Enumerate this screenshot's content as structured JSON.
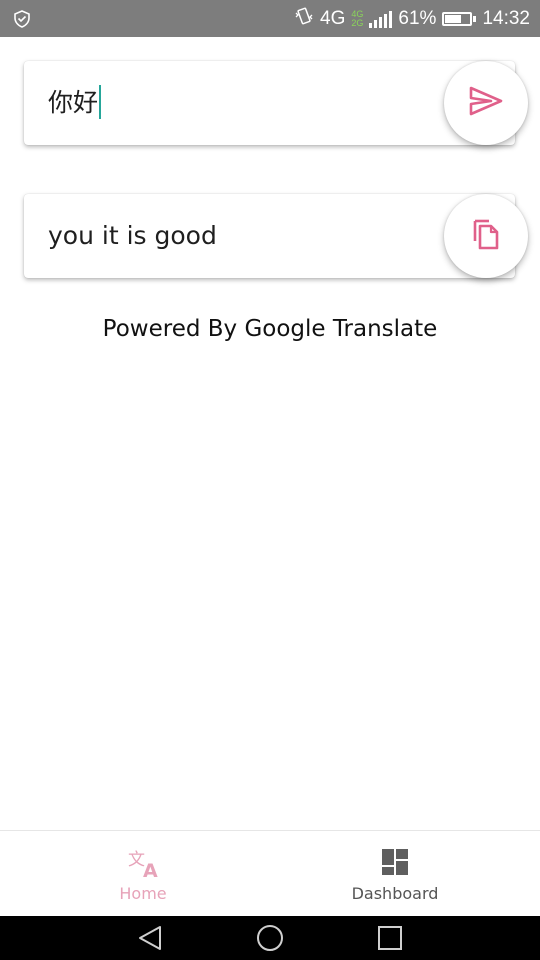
{
  "status_bar": {
    "network_primary": "4G",
    "network_secondary_top": "4G",
    "network_secondary_bottom": "2G",
    "battery": "61%",
    "time": "14:32",
    "left_icon": "shield-icon",
    "right_icons": [
      "vibrate-icon",
      "signal-icon",
      "battery-icon"
    ]
  },
  "input_card": {
    "text": "你好",
    "action_icon": "send-icon"
  },
  "output_card": {
    "text": "you it is good",
    "action_icon": "copy-icon"
  },
  "footer_text": "Powered By Google Translate",
  "bottom_nav": {
    "items": [
      {
        "label": "Home",
        "icon": "translate-icon",
        "active": true
      },
      {
        "label": "Dashboard",
        "icon": "dashboard-icon",
        "active": false
      }
    ]
  },
  "system_nav": {
    "icons": [
      "back-icon",
      "home-circle-icon",
      "recent-apps-icon"
    ]
  },
  "colors": {
    "accent": "#e0608a",
    "accent_light": "#e7a3b9",
    "status_bar_bg": "#7d7d7d",
    "cursor": "#26a69a",
    "system_nav_bg": "#000000"
  }
}
